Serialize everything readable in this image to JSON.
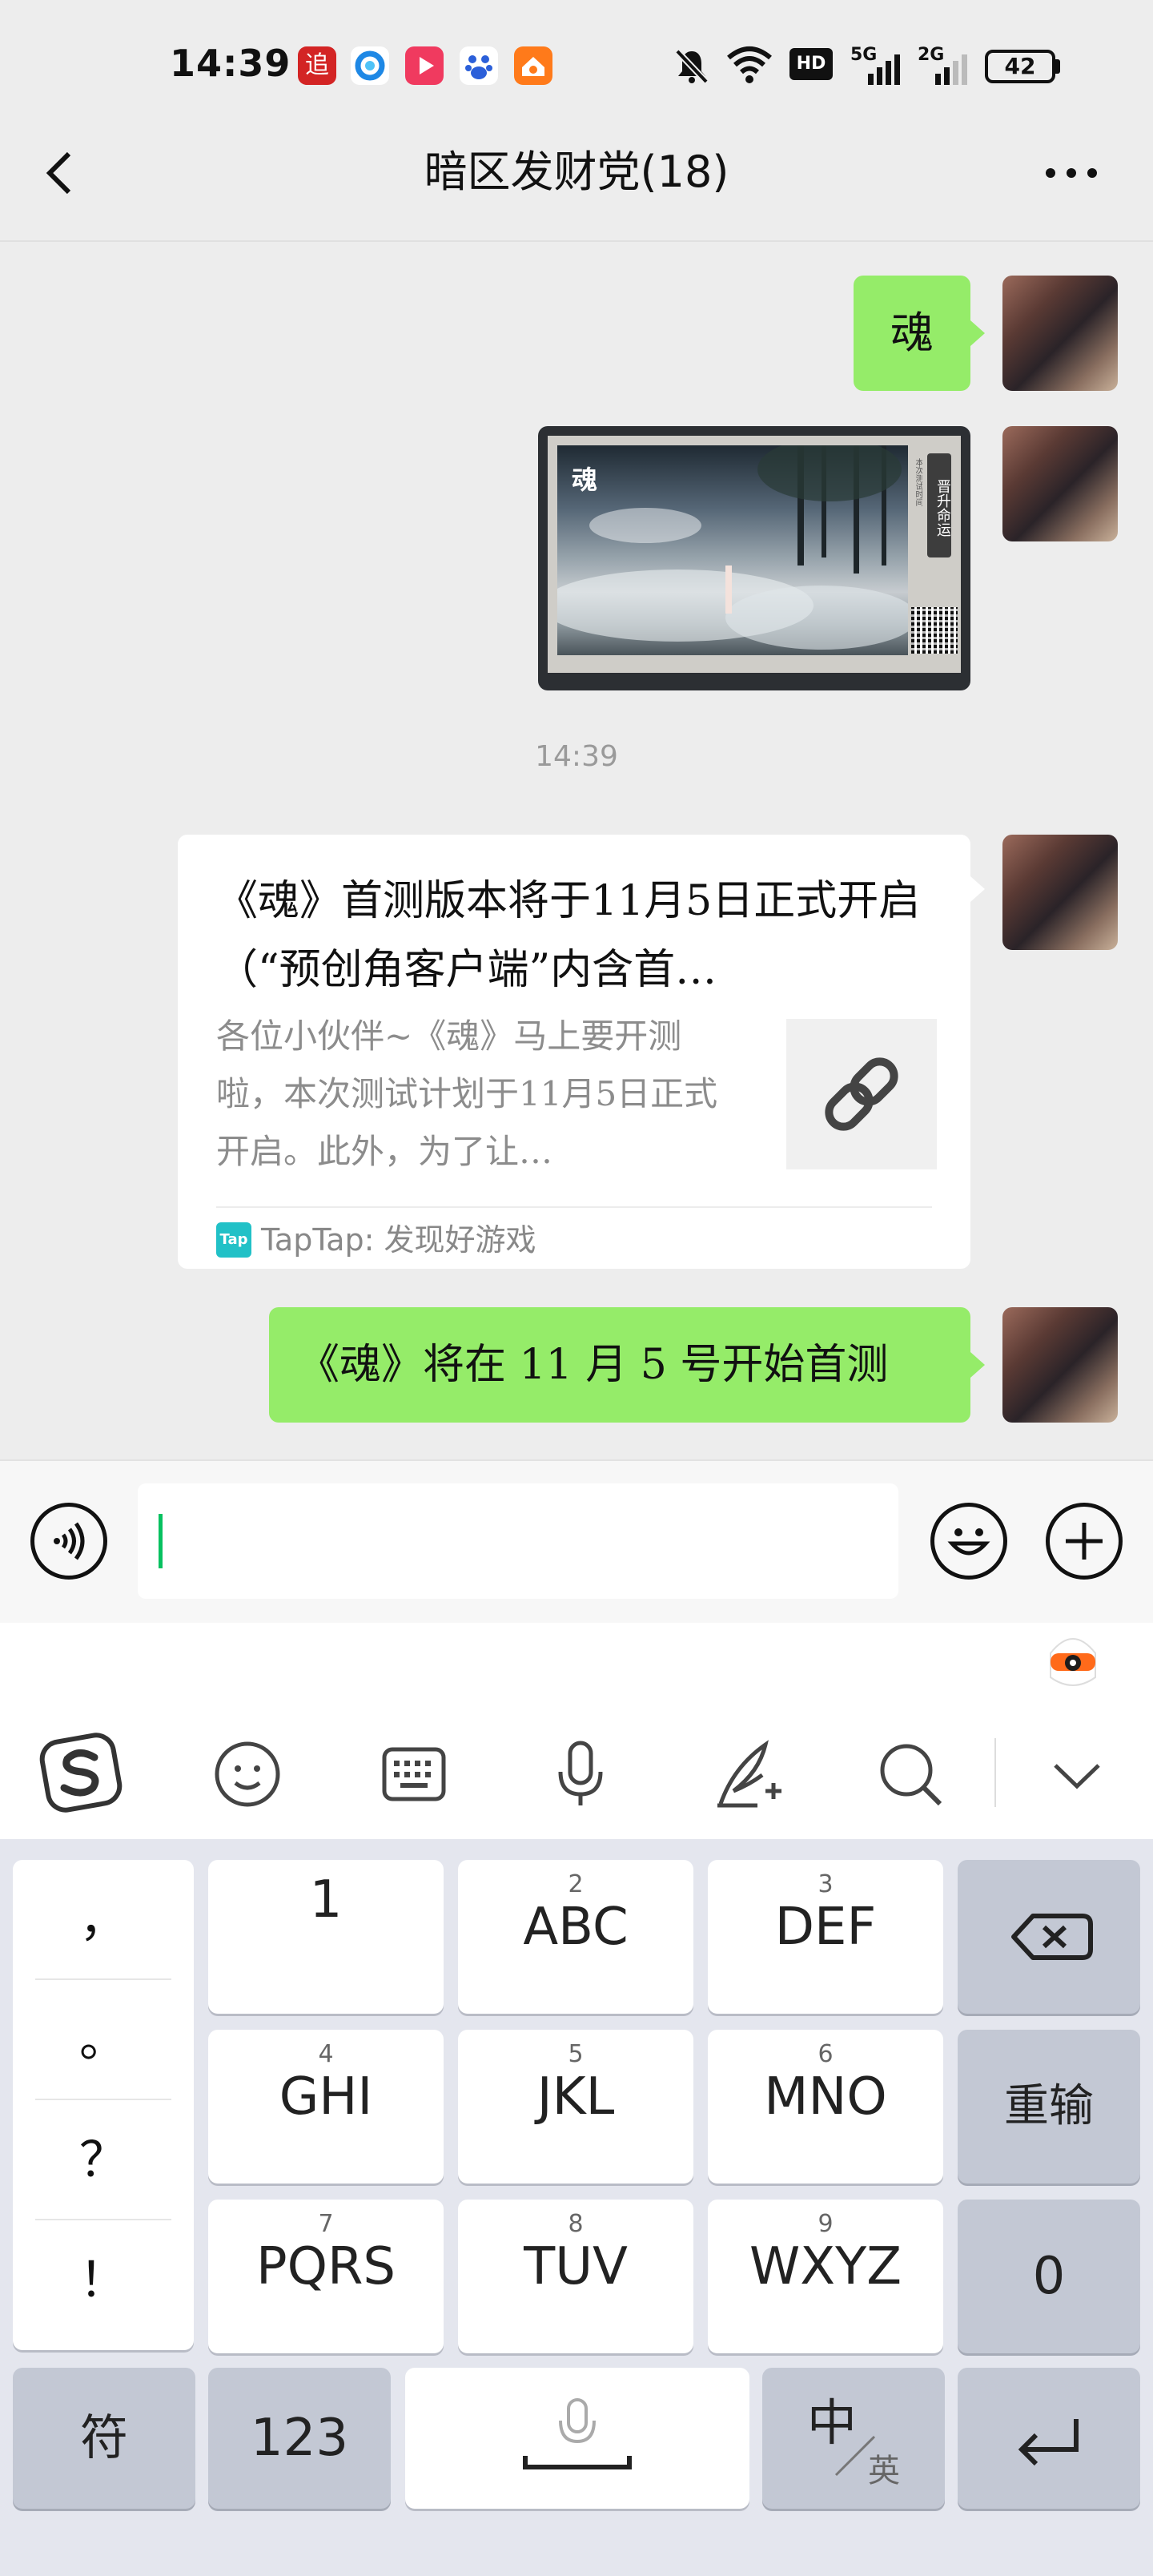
{
  "status_bar": {
    "time": "14:39",
    "battery": "42",
    "network_a": "5G",
    "network_b": "2G",
    "hd_badge": "HD",
    "app_icons": [
      "追",
      "browser",
      "video",
      "baidu",
      "home"
    ]
  },
  "nav": {
    "back_icon": "chevron-left-icon",
    "title": "暗区发财党(18)",
    "more_icon": "more-dots-icon"
  },
  "messages": [
    {
      "type": "text",
      "from": "self",
      "text": "魂"
    },
    {
      "type": "image",
      "from": "self",
      "overlay_title": "魂",
      "side_text": "晋升命运",
      "caption": "本次测试时间"
    },
    {
      "type": "timestamp",
      "text": "14:39"
    },
    {
      "type": "link_card",
      "from": "self",
      "title": "《魂》首测版本将于11月5日正式开启（“预创角客户端”内含首…",
      "summary": "各位小伙伴~《魂》马上要开测啦，本次测试计划于11月5日正式开启。此外，为了让…",
      "source_badge": "Tap",
      "source": "TapTap: 发现好游戏"
    },
    {
      "type": "text",
      "from": "self",
      "text": "《魂》将在 11 月 5 号开始首测"
    }
  ],
  "input_bar": {
    "voice_icon": "voice-icon",
    "text_value": "",
    "emoji_icon": "emoji-icon",
    "plus_icon": "plus-icon"
  },
  "ime_toolbar": {
    "logo_icon": "sogou-logo-icon",
    "items": [
      "emoji-icon",
      "keyboard-icon",
      "microphone-icon",
      "handwriting-icon",
      "search-icon"
    ],
    "collapse_icon": "chevron-down-icon",
    "mascot_icon": "mascot-icon"
  },
  "keyboard": {
    "punct": [
      "，",
      "。",
      "？",
      "！"
    ],
    "rows": [
      [
        {
          "num": "",
          "label": "1"
        },
        {
          "num": "2",
          "label": "ABC"
        },
        {
          "num": "3",
          "label": "DEF"
        }
      ],
      [
        {
          "num": "4",
          "label": "GHI"
        },
        {
          "num": "5",
          "label": "JKL"
        },
        {
          "num": "6",
          "label": "MNO"
        }
      ],
      [
        {
          "num": "7",
          "label": "PQRS"
        },
        {
          "num": "8",
          "label": "TUV"
        },
        {
          "num": "9",
          "label": "WXYZ"
        }
      ]
    ],
    "backspace_icon": "backspace-icon",
    "reinput": "重输",
    "zero": "0",
    "symbol": "符",
    "num123": "123",
    "space_mic_icon": "microphone-icon",
    "lang_main": "中",
    "lang_sub": "英",
    "enter_icon": "enter-icon"
  }
}
